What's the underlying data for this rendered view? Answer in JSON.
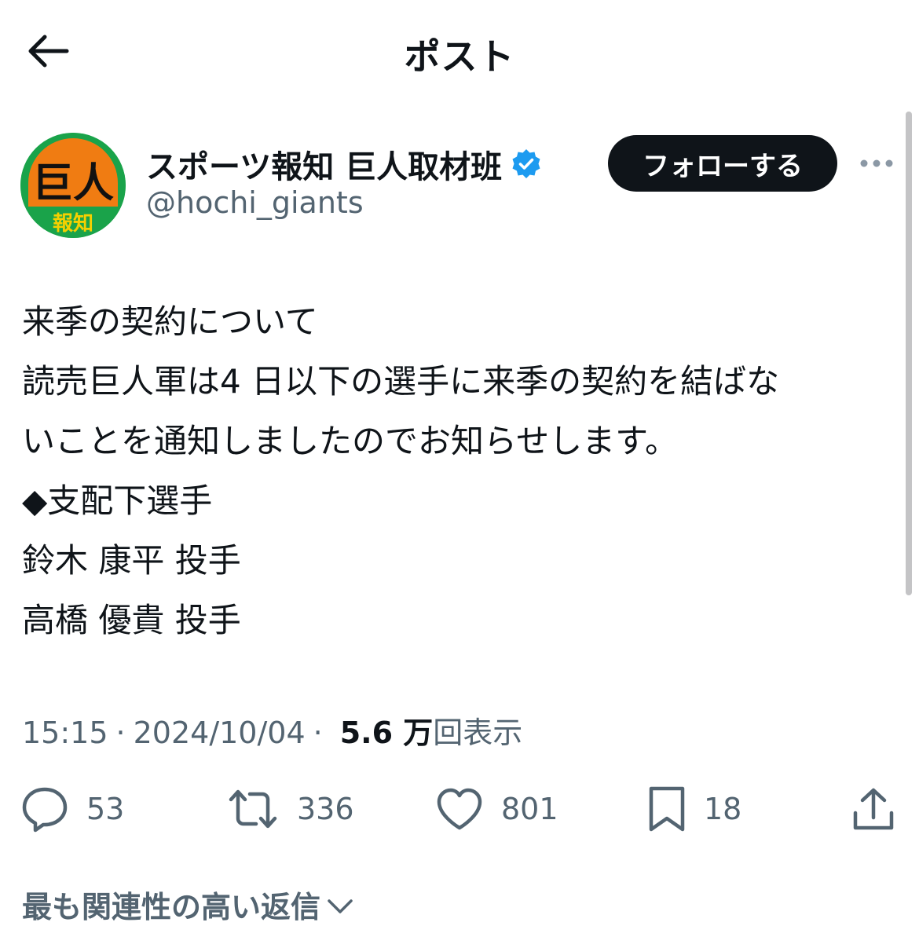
{
  "header": {
    "title": "ポスト",
    "back_icon": "arrow-left-icon"
  },
  "author": {
    "display_name": "スポーツ報知 巨人取材班",
    "handle": "@hochi_giants",
    "avatar": {
      "logo_text_top": "巨人",
      "logo_text_bottom": "報知",
      "colors": {
        "ring": "#1aa34a",
        "fill": "#f07c12",
        "text": "#111111",
        "bottom_text": "#f5d000"
      }
    },
    "verified_icon": "verified-badge-icon",
    "follow_label": "フォローする",
    "more_icon": "more-horizontal-icon"
  },
  "tweet": {
    "lines": [
      "来季の契約について",
      "読売巨人軍は4 日以下の選手に来季の契約を結ばな",
      "いことを通知しましたのでお知らせします。",
      "◆支配下選手",
      "鈴木 康平 投手",
      "高橋 優貴 投手"
    ],
    "time": "15:15",
    "date": "2024/10/04",
    "separator": "·",
    "views_count": "5.6 万",
    "views_label": "回表示"
  },
  "actions": {
    "reply": {
      "icon": "reply-icon",
      "count": "53"
    },
    "retweet": {
      "icon": "retweet-icon",
      "count": "336"
    },
    "like": {
      "icon": "heart-icon",
      "count": "801"
    },
    "bookmark": {
      "icon": "bookmark-icon",
      "count": "18"
    },
    "share": {
      "icon": "share-icon"
    }
  },
  "replies": {
    "sort_label": "最も関連性の高い返信",
    "sort_icon": "chevron-down-icon"
  },
  "colors": {
    "text": "#0f1419",
    "secondary": "#536471",
    "verified": "#1d9bf0",
    "button_bg": "#0f1419"
  }
}
